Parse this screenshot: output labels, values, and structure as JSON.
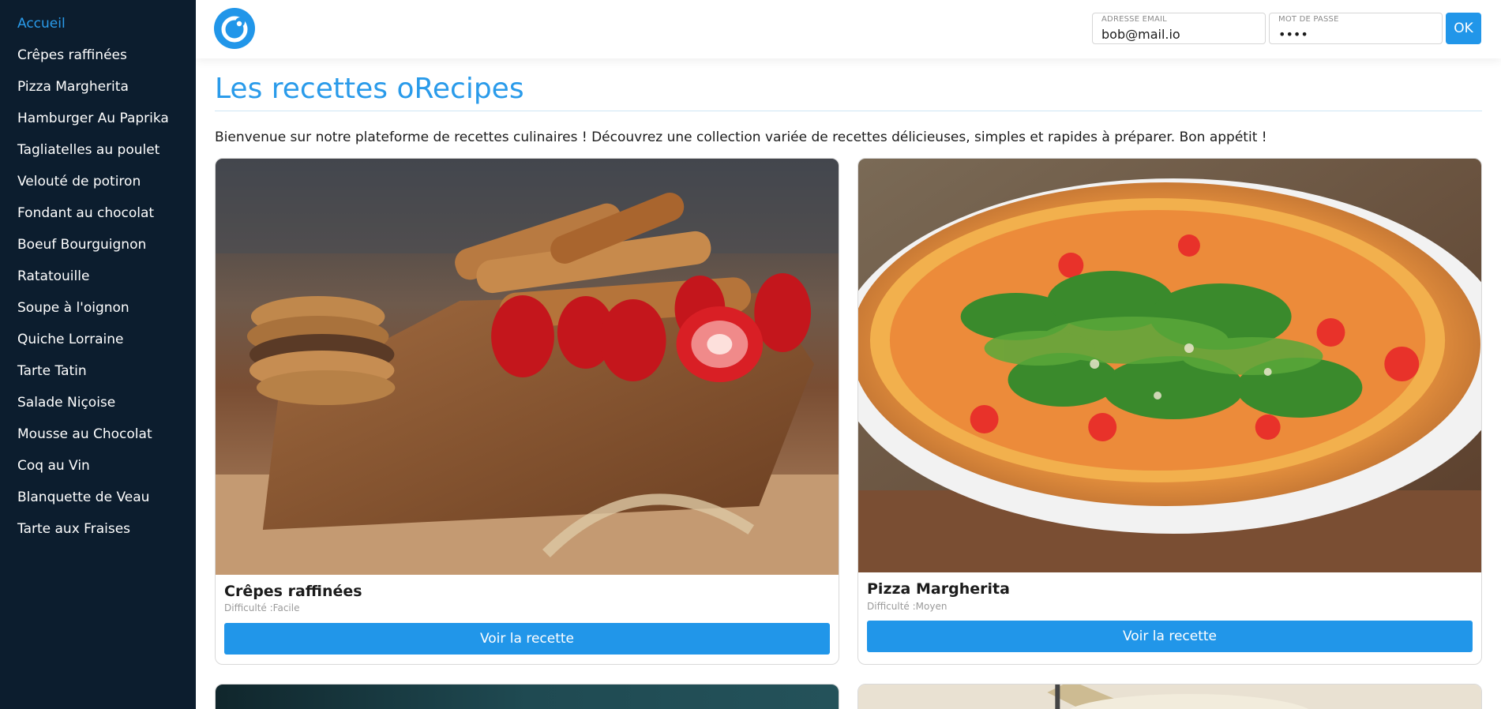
{
  "sidebar": {
    "items": [
      {
        "label": "Accueil",
        "active": true
      },
      {
        "label": "Crêpes raffinées"
      },
      {
        "label": "Pizza Margherita"
      },
      {
        "label": "Hamburger Au Paprika"
      },
      {
        "label": "Tagliatelles au poulet"
      },
      {
        "label": "Velouté de potiron"
      },
      {
        "label": "Fondant au chocolat"
      },
      {
        "label": "Boeuf Bourguignon"
      },
      {
        "label": "Ratatouille"
      },
      {
        "label": "Soupe à l'oignon"
      },
      {
        "label": "Quiche Lorraine"
      },
      {
        "label": "Tarte Tatin"
      },
      {
        "label": "Salade Niçoise"
      },
      {
        "label": "Mousse au Chocolat"
      },
      {
        "label": "Coq au Vin"
      },
      {
        "label": "Blanquette de Veau"
      },
      {
        "label": "Tarte aux Fraises"
      }
    ]
  },
  "header": {
    "logo_icon": "orecipes-logo-icon",
    "login": {
      "email_label": "ADRESSE EMAIL",
      "email_value": "bob@mail.io",
      "password_label": "MOT DE PASSE",
      "password_value": "••••",
      "submit_label": "OK"
    }
  },
  "main": {
    "title": "Les recettes oRecipes",
    "intro": "Bienvenue sur notre plateforme de recettes culinaires ! Découvrez une collection variée de recettes délicieuses, simples et rapides à préparer. Bon appétit !",
    "recipes": [
      {
        "title": "Crêpes raffinées",
        "difficulty": "Difficulté :Facile",
        "button_label": "Voir la recette"
      },
      {
        "title": "Pizza Margherita",
        "difficulty": "Difficulté :Moyen",
        "button_label": "Voir la recette"
      }
    ]
  },
  "colors": {
    "accent": "#2196e9",
    "sidebar_bg": "#0c1d2e",
    "sidebar_text": "#ffffff",
    "active_link": "#2a9bea"
  }
}
